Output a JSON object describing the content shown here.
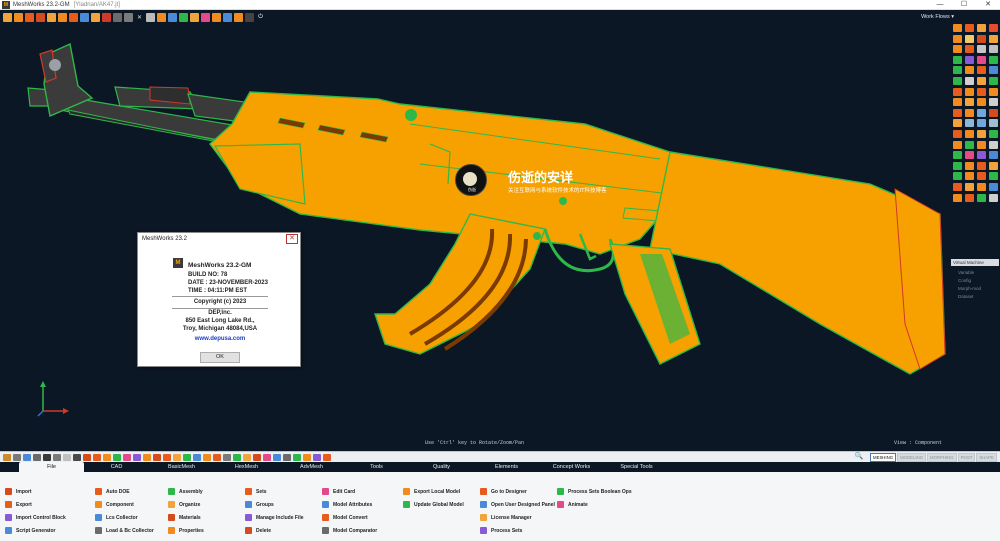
{
  "window": {
    "title": "MeshWorks 23.2-GM",
    "path": "[Yladrian/AK47.jt]",
    "logo_text": "M",
    "controls": [
      "—",
      "☐",
      "✕"
    ]
  },
  "toolbar": {
    "icons": [
      "open-icon",
      "save-icon",
      "import-icon",
      "export-icon",
      "undo-icon",
      "redo-icon",
      "cut-icon",
      "copy-icon",
      "paste-icon",
      "delete-icon",
      "print-icon",
      "settings-icon",
      "close-icon",
      "select-box-icon",
      "filter-icon",
      "grid-icon",
      "tree-icon",
      "layers-icon",
      "color-icon",
      "stats-icon",
      "info-icon",
      "mesh-icon",
      "logo-small-icon",
      "power-icon"
    ],
    "workflows_label": "Work Flows ▾"
  },
  "viewport": {
    "hint": "Use 'Ctrl' key to Rotate/Zoom/Pan",
    "view_label": "View : Component",
    "model_color": "#f6a100",
    "feature_line_color": "#2fb84a",
    "background": "#0c1725"
  },
  "right_panel": {
    "section_label": "Virtual Machine",
    "items": [
      "Variable",
      "Config",
      "Morph-mod",
      "Dataset"
    ],
    "colors": [
      "#f28b1e",
      "#e75c1c",
      "#f2a43c",
      "#e64c2e",
      "#f28b1e",
      "#f4c86a",
      "#d44c1e",
      "#f2a43c",
      "#f28b1e",
      "#e75c1c",
      "#c6c6c6",
      "#bfbfbf",
      "#2fb84a",
      "#8a5ad6",
      "#e44a8a",
      "#2fb84a",
      "#2fb84a",
      "#f28b1e",
      "#e75c1c",
      "#4a8ad6",
      "#2fb84a",
      "#cfcfcf",
      "#f2a43c",
      "#2fb84a",
      "#e75c1c",
      "#f28b1e",
      "#e75c1c",
      "#f28b1e",
      "#f28b1e",
      "#f2a43c",
      "#f28b1e",
      "#cfcfcf",
      "#e75c1c",
      "#f28b1e",
      "#6fa8dc",
      "#d44c1e",
      "#f2a43c",
      "#8fb8d8",
      "#6fa8dc",
      "#a0c0d0",
      "#e75c1c",
      "#f28b1e",
      "#f2a43c",
      "#2fb84a",
      "#f28b1e",
      "#2fb84a",
      "#f28b1e",
      "#cfcfcf",
      "#2fb84a",
      "#e44a8a",
      "#8a5ad6",
      "#4a8ad6",
      "#2fb84a",
      "#f28b1e",
      "#e75c1c",
      "#f2a43c",
      "#2fb84a",
      "#f28b1e",
      "#e75c1c",
      "#2fb84a",
      "#e75c1c",
      "#f2a43c",
      "#f28b1e",
      "#4a8ad6",
      "#f28b1e",
      "#e75c1c",
      "#2fb84a",
      "#cfcfcf"
    ]
  },
  "watermark": {
    "title": "伤逝的安详",
    "subtitle": "关注互联网与系统软件技术的IT科技博客",
    "badge": "伤逝"
  },
  "about_dialog": {
    "title": "MeshWorks 23.2",
    "close_label": "✕",
    "logo_text": "M",
    "product": "MeshWorks 23.2-GM",
    "build": "BUILD NO: 78",
    "date": "DATE : 23-NOVEMBER-2023",
    "time": "TIME : 04:11:PM EST",
    "copyright": "Copyright (c) 2023",
    "company": "DEP,Inc.",
    "address1": "850 East Long Lake Rd.,",
    "address2": "Troy, Michigan 48084,USA",
    "url": "www.depusa.com",
    "ok_label": "OK"
  },
  "status_bar": {
    "search_icon": "🔍",
    "modes": [
      "MESHING",
      "MODELING",
      "MORPHING",
      "POST",
      "SHAPE"
    ],
    "active_mode": "MESHING",
    "icons": [
      "#d08a2a",
      "#7a7a7a",
      "#4a8ad6",
      "#6b6b6b",
      "#3a3a3a",
      "#7a7a7a",
      "#c0c0c0",
      "#4a4a4a",
      "#d44c1e",
      "#e75c1c",
      "#f28b1e",
      "#2fb84a",
      "#e44a8a",
      "#8a5ad6",
      "#f28b1e",
      "#d44c1e",
      "#e75c1c",
      "#f2a43c",
      "#2fb84a",
      "#4a8ad6",
      "#f28b1e",
      "#e75c1c",
      "#7a7a7a",
      "#2fb84a",
      "#f2a43c",
      "#d44c1e",
      "#e44a8a",
      "#4a8ad6",
      "#6b6b6b",
      "#2fb84a",
      "#f28b1e",
      "#8a5ad6",
      "#e75c1c"
    ]
  },
  "tabs": [
    "File",
    "CAD",
    "BasicMesh",
    "HexMesh",
    "AdvMesh",
    "Tools",
    "Quality",
    "Elements",
    "Concept Works",
    "Special Tools"
  ],
  "active_tab": "File",
  "ribbon": {
    "columns": [
      {
        "items": [
          {
            "label": "Import",
            "icon": "#d44c1e"
          },
          {
            "label": "Export",
            "icon": "#e75c1c"
          },
          {
            "label": "Import Control Block",
            "icon": "#8a5ad6"
          },
          {
            "label": "Script Generator",
            "icon": "#4a8ad6"
          }
        ]
      },
      {
        "items": [
          {
            "label": "Auto DOE",
            "icon": "#e75c1c"
          },
          {
            "label": "Component",
            "icon": "#f28b1e"
          },
          {
            "label": "Lcs Collector",
            "icon": "#4a8ad6"
          },
          {
            "label": "Load & Bc Collector",
            "icon": "#6b6b6b"
          }
        ]
      },
      {
        "items": [
          {
            "label": "Assembly",
            "icon": "#2fb84a"
          },
          {
            "label": "Organize",
            "icon": "#f2a43c"
          },
          {
            "label": "Materials",
            "icon": "#d44c1e"
          },
          {
            "label": "Properties",
            "icon": "#f28b1e"
          }
        ]
      },
      {
        "items": [
          {
            "label": "Sets",
            "icon": "#e75c1c"
          },
          {
            "label": "Groups",
            "icon": "#4a8ad6"
          },
          {
            "label": "Manage Include File",
            "icon": "#8a5ad6"
          },
          {
            "label": "Delete",
            "icon": "#d44c1e"
          }
        ]
      },
      {
        "items": [
          {
            "label": "Edit Card",
            "icon": "#e44a8a"
          },
          {
            "label": "Model Attributes",
            "icon": "#4a8ad6"
          },
          {
            "label": "Model Convert",
            "icon": "#e75c1c"
          },
          {
            "label": "Model Comparator",
            "icon": "#6b6b6b"
          }
        ]
      },
      {
        "items": [
          {
            "label": "Export Local Model",
            "icon": "#f28b1e"
          },
          {
            "label": "Update Global Model",
            "icon": "#2fb84a"
          }
        ]
      },
      {
        "items": [
          {
            "label": "Go to Designer",
            "icon": "#e75c1c"
          },
          {
            "label": "Open User Designed Panel",
            "icon": "#4a8ad6"
          },
          {
            "label": "License Manager",
            "icon": "#f2a43c"
          },
          {
            "label": "Process Sets",
            "icon": "#8a5ad6"
          }
        ]
      },
      {
        "items": [
          {
            "label": "Process Sets Boolean Ops",
            "icon": "#2fb84a"
          },
          {
            "label": "Animate",
            "icon": "#e44a8a"
          }
        ]
      }
    ]
  }
}
